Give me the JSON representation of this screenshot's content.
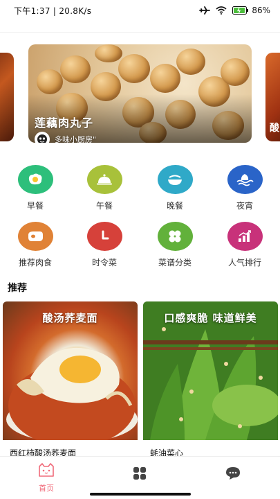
{
  "status_bar": {
    "time_speed": "下午1:37 | 20.8K/s",
    "battery": "86%"
  },
  "banner": {
    "title": "莲藕肉丸子",
    "author": "多味小厨房\"",
    "next_slide_peek": "酸"
  },
  "categories": [
    {
      "label": "早餐",
      "color": "#2dbf7b"
    },
    {
      "label": "午餐",
      "color": "#a8c13a"
    },
    {
      "label": "晚餐",
      "color": "#2fa9c8"
    },
    {
      "label": "夜宵",
      "color": "#2a64c8"
    },
    {
      "label": "推荐肉食",
      "color": "#e08236"
    },
    {
      "label": "时令菜",
      "color": "#d6413a"
    },
    {
      "label": "菜谱分类",
      "color": "#62b13b"
    },
    {
      "label": "人气排行",
      "color": "#c8327a"
    }
  ],
  "recommend": {
    "title": "推荐",
    "cards": [
      {
        "caption": "酸汤荞麦面",
        "name": "西红柿酸汤荞麦面"
      },
      {
        "caption": "口感爽脆 味道鲜美",
        "name": "蚝油菜心"
      }
    ]
  },
  "bottom_nav": {
    "home_label": "首页",
    "accent": "#f06b7a"
  }
}
